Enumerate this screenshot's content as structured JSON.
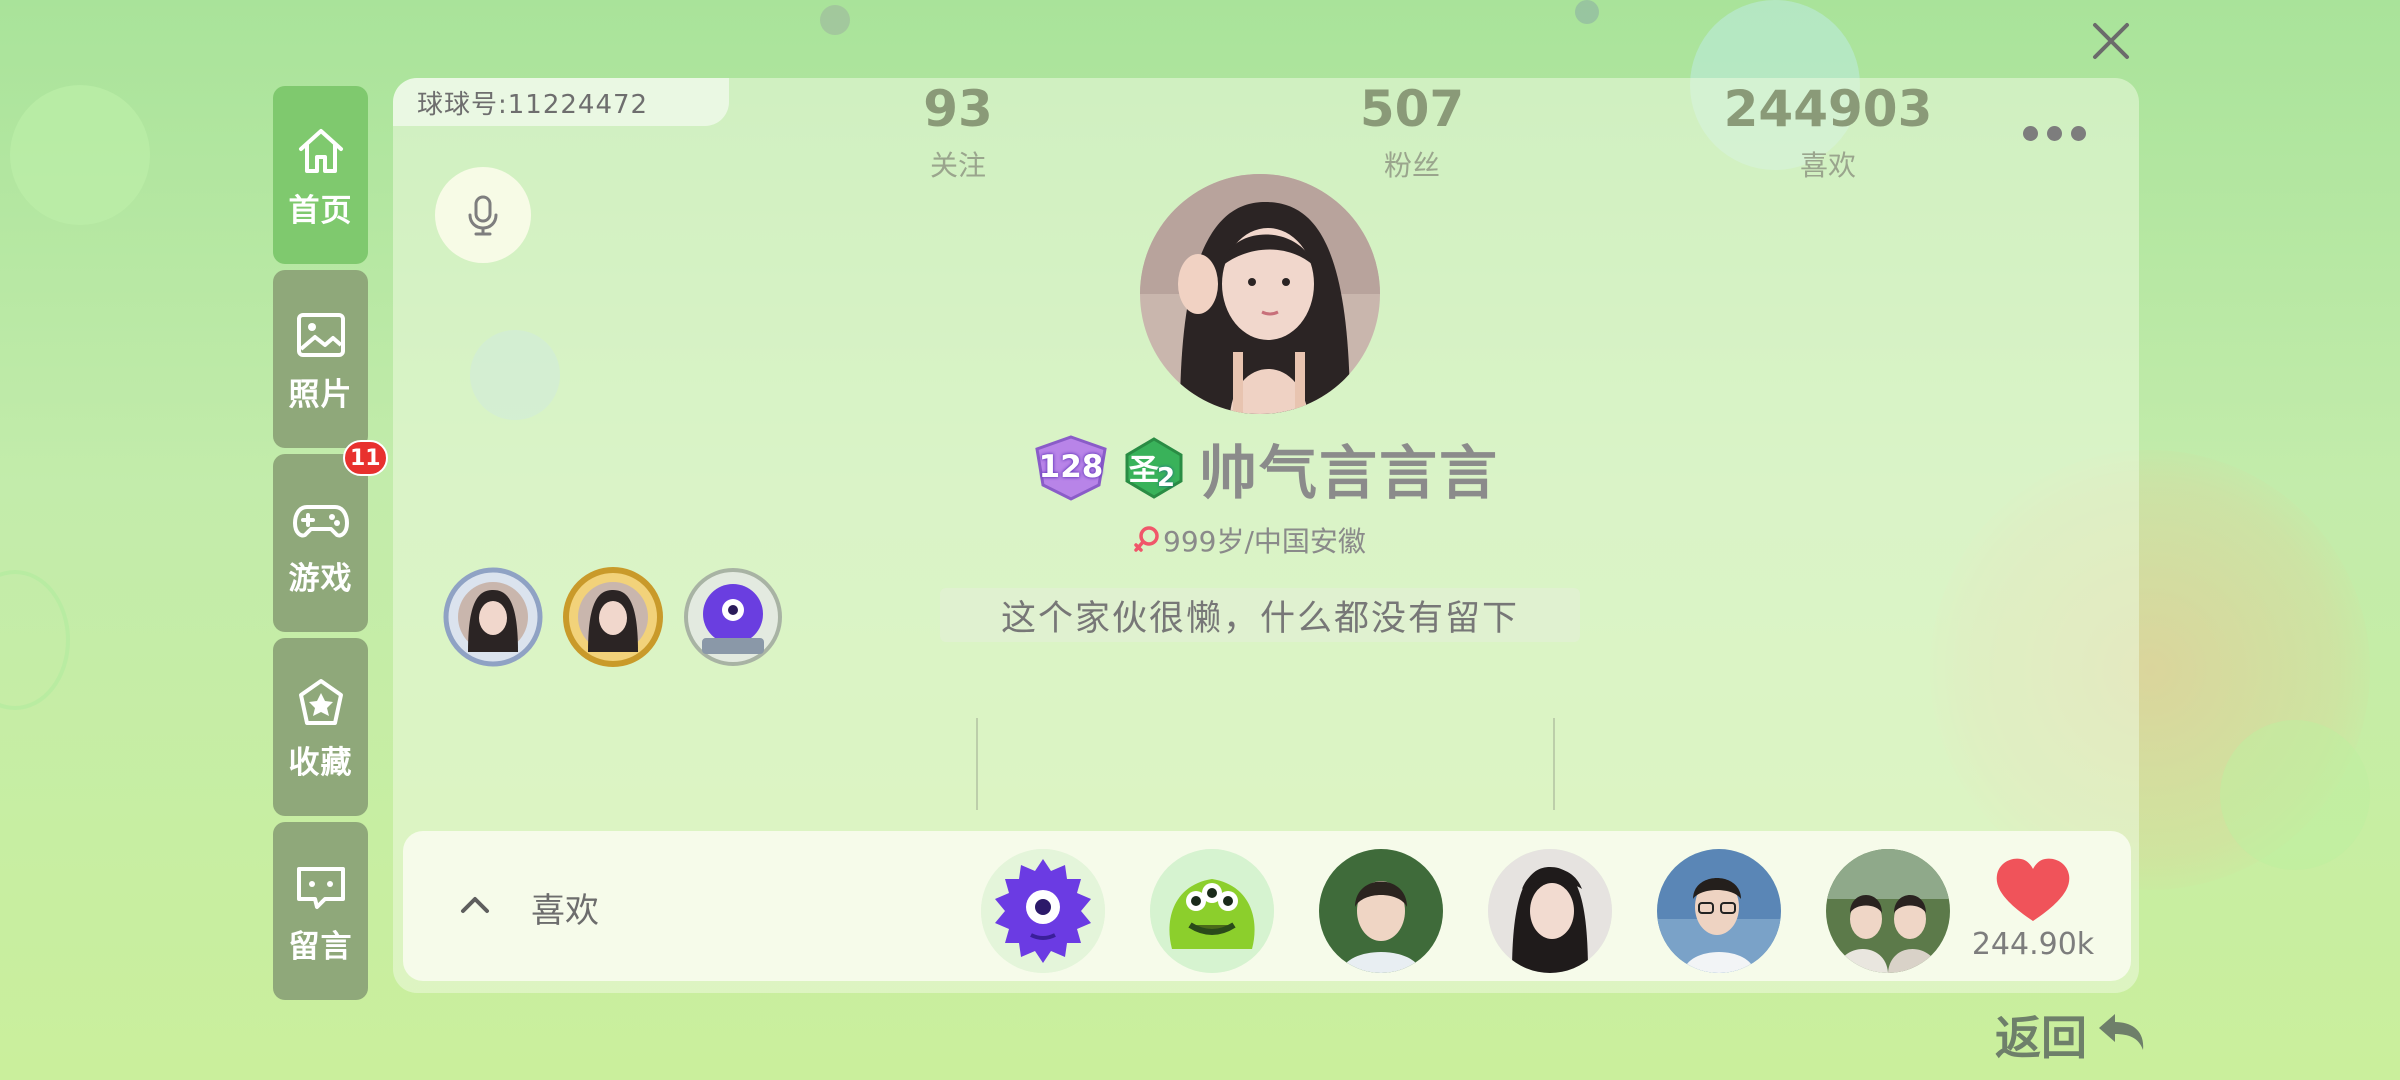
{
  "topbar": {
    "close_icon": "close-icon"
  },
  "sidebar": {
    "items": [
      {
        "label": "首页",
        "icon": "home-icon",
        "active": true
      },
      {
        "label": "照片",
        "icon": "image-icon",
        "active": false
      },
      {
        "label": "游戏",
        "icon": "gamepad-icon",
        "active": false,
        "badge": "11"
      },
      {
        "label": "收藏",
        "icon": "star-icon",
        "active": false
      },
      {
        "label": "留言",
        "icon": "message-icon",
        "active": false
      }
    ]
  },
  "profile": {
    "id_label": "球球号:11224472",
    "more_icon": "more-icon",
    "voice_icon": "microphone-icon",
    "avatar": "profile-avatar",
    "level": "128",
    "rank_char": "圣",
    "rank_num": "2",
    "nickname": "帅气言言言",
    "gender": "female",
    "info": "999岁/中国安徽",
    "bio": "这个家伙很懒，什么都没有留下",
    "medals": [
      "medal-silver-frame",
      "medal-gold-frame",
      "medal-purple-monster"
    ]
  },
  "stats": [
    {
      "value": "93",
      "label": "关注"
    },
    {
      "value": "507",
      "label": "粉丝"
    },
    {
      "value": "244903",
      "label": "喜欢"
    }
  ],
  "likes": {
    "label": "喜欢",
    "toggle_icon": "chevron-up-icon",
    "count": "244.90k",
    "heart_color": "#f0535a",
    "likers": [
      "purple-monster",
      "green-monster",
      "boy-photo",
      "girl-photo",
      "boy-glasses-photo",
      "couple-photo"
    ]
  },
  "footer": {
    "back_label": "返回",
    "back_icon": "back-arrow-icon"
  },
  "colors": {
    "sidebar_active": "#7fc96e",
    "sidebar_inactive": "#8fa87a",
    "badge": "#e8312e",
    "stat_number": "#8a9a78"
  }
}
